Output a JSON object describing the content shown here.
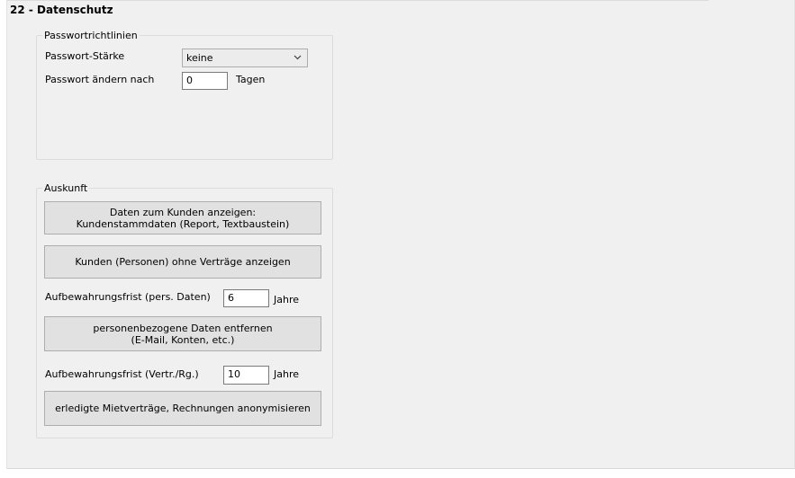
{
  "header": {
    "title": "22 - Datenschutz"
  },
  "password_group": {
    "legend": "Passwortrichtlinien",
    "strength_label": "Passwort-Stärke",
    "strength_value": "keine",
    "change_label": "Passwort ändern nach",
    "change_value": "0",
    "change_unit": "Tagen"
  },
  "info_group": {
    "legend": "Auskunft",
    "show_data_button": {
      "line1": "Daten zum Kunden anzeigen:",
      "line2": "Kundenstammdaten (Report, Textbaustein)"
    },
    "no_contracts_button": "Kunden (Personen) ohne Verträge anzeigen",
    "retention_personal_label": "Aufbewahrungsfrist (pers. Daten)",
    "retention_personal_value": "6",
    "retention_personal_unit": "Jahre",
    "remove_data_button": {
      "line1": "personenbezogene Daten entfernen",
      "line2": "(E-Mail, Konten, etc.)"
    },
    "retention_contract_label": "Aufbewahrungsfrist (Vertr./Rg.)",
    "retention_contract_value": "10",
    "retention_contract_unit": "Jahre",
    "anonymize_button": "erledigte Mietverträge, Rechnungen anonymisieren"
  }
}
